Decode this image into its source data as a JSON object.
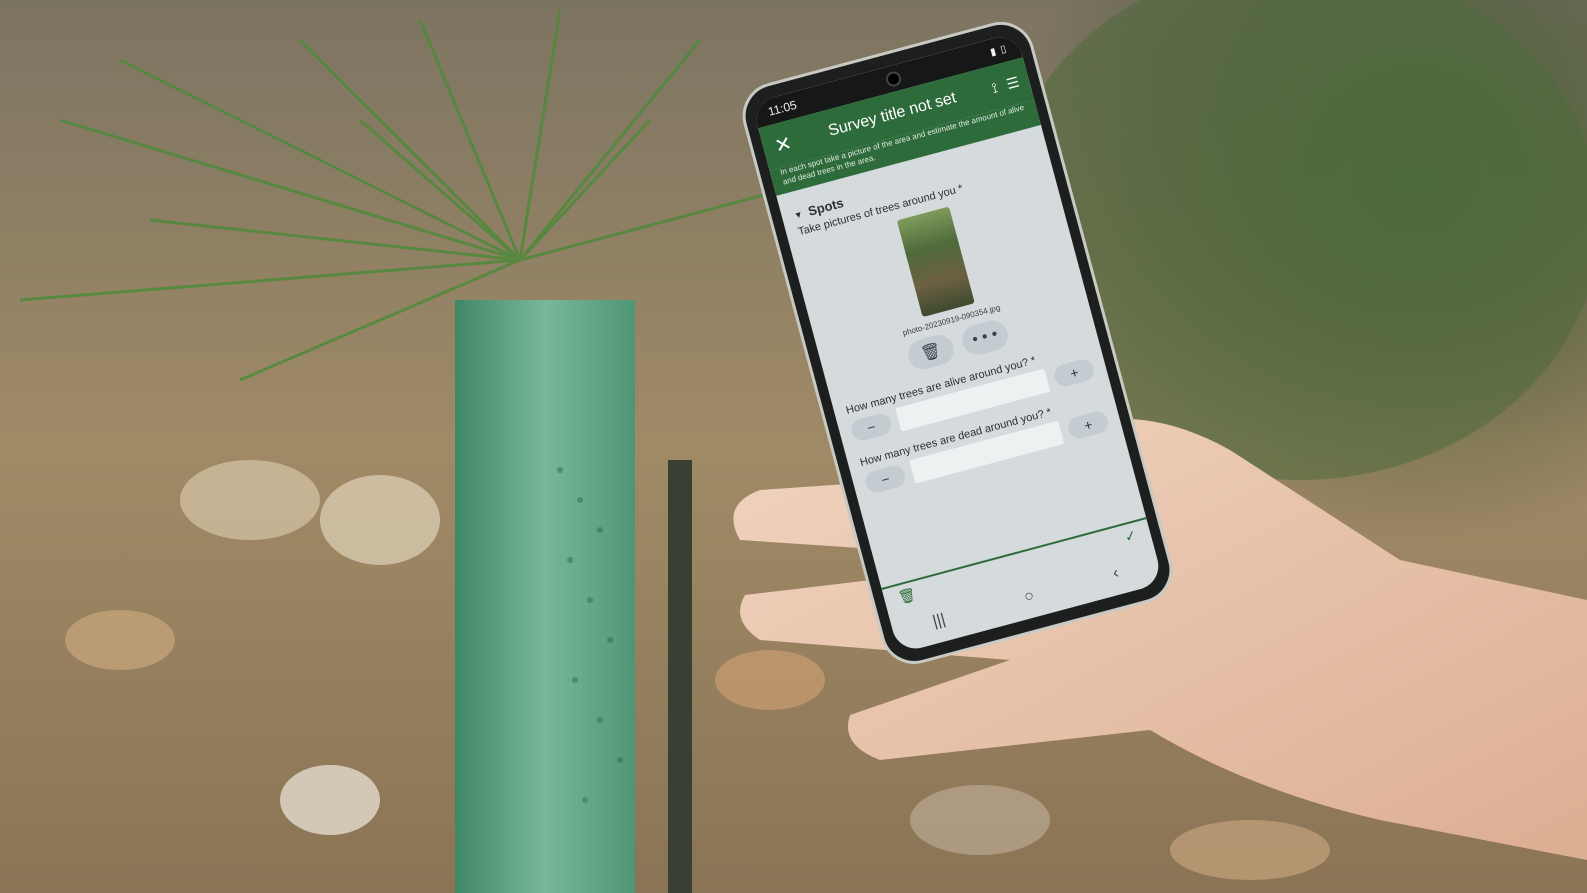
{
  "status": {
    "time": "11:05"
  },
  "app": {
    "title": "Survey title not set",
    "intro": "In each spot take a picture of the area and estimate the amount of alive and dead trees in the area."
  },
  "spots": {
    "section": "Spots",
    "question": "Take pictures of trees around you *",
    "filename": "photo-20230919-090354.jpg",
    "more_glyph": "• • •"
  },
  "counts": {
    "alive_question": "How many trees are alive around you? *",
    "dead_question": "How many trees are dead around you? *",
    "minus": "−",
    "plus": "+"
  },
  "icons": {
    "close": "close-icon",
    "satellite": "satellite-icon",
    "menu": "menu-icon",
    "trash": "trash-icon",
    "check": "check-icon",
    "back": "back-icon",
    "home": "home-icon",
    "recent": "recent-apps-icon"
  }
}
